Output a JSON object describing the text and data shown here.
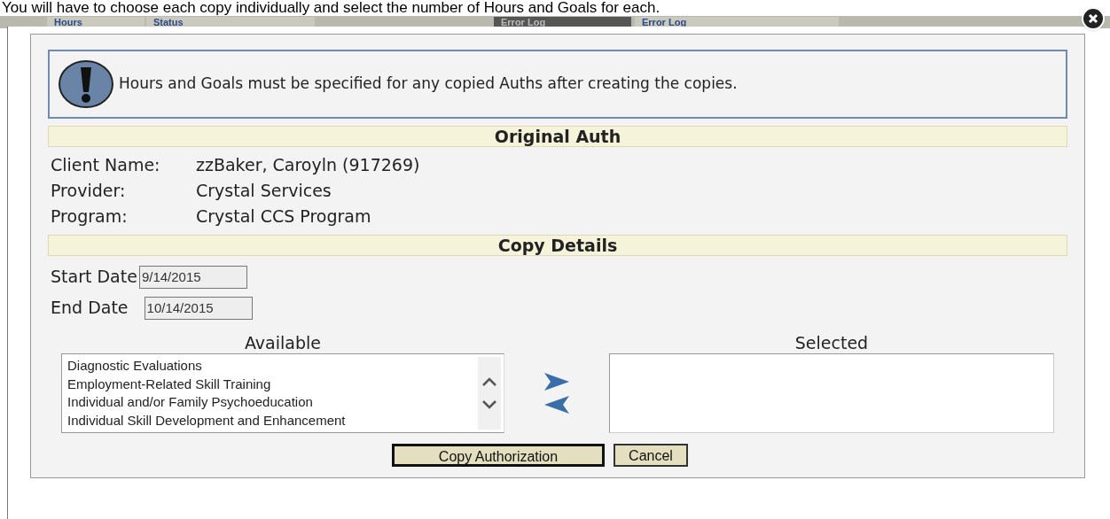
{
  "instruction": "You will have to choose each copy individually and select the number of Hours and Goals for each.",
  "background_headers": [
    {
      "label": "Hours",
      "kind": "light"
    },
    {
      "label": "Status",
      "kind": "light"
    },
    {
      "label": "Error Log",
      "kind": "dark"
    },
    {
      "label": "Error Log",
      "kind": "light"
    }
  ],
  "dialog": {
    "message": "Hours and Goals must be specified for any copied Auths after creating the copies.",
    "original_auth": {
      "heading": "Original Auth",
      "fields": [
        {
          "label": "Client Name:",
          "value": "zzBaker, Caroyln (917269)"
        },
        {
          "label": "Provider:",
          "value": "Crystal Services"
        },
        {
          "label": "Program:",
          "value": "Crystal CCS Program"
        }
      ]
    },
    "copy_details": {
      "heading": "Copy Details",
      "start_date": {
        "label": "Start Date",
        "value": "9/14/2015"
      },
      "end_date": {
        "label": "End Date",
        "value": "10/14/2015"
      },
      "available": {
        "heading": "Available",
        "items": [
          "Diagnostic Evaluations",
          "Employment-Related Skill Training",
          "Individual and/or Family Psychoeducation",
          "Individual Skill Development and Enhancement"
        ]
      },
      "selected": {
        "heading": "Selected"
      }
    },
    "buttons": [
      {
        "label": "Copy Authorization",
        "kind": "primary"
      },
      {
        "label": "Cancel",
        "kind": "secondary"
      }
    ]
  }
}
